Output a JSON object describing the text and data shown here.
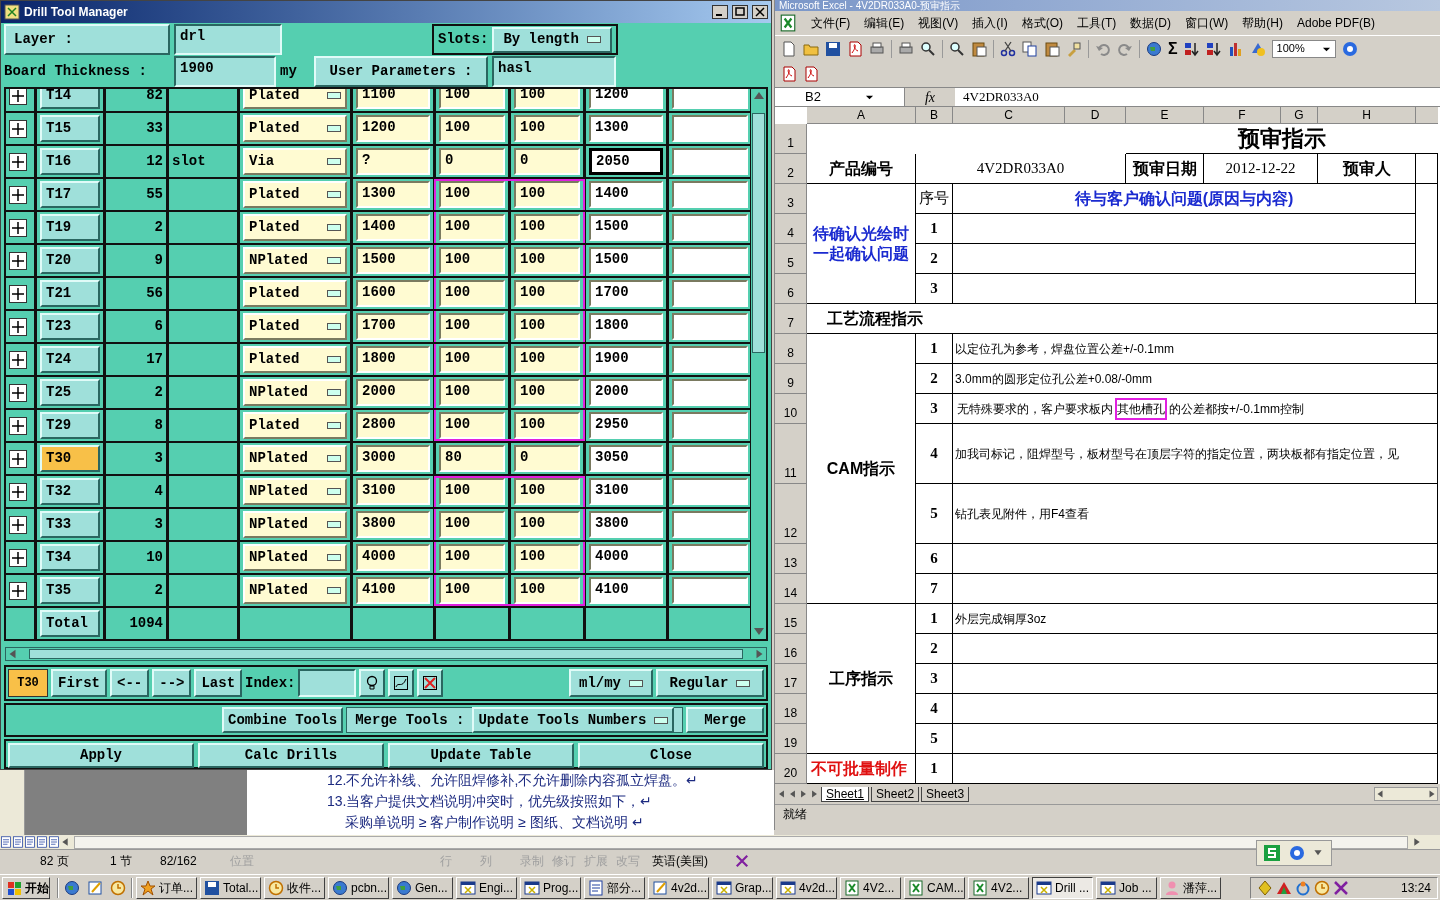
{
  "drill_window": {
    "title": "Drill Tool Manager",
    "layer_label": "Layer :",
    "layer_value": "drl",
    "slots_label": "Slots:",
    "slots_value": "By length",
    "thickness_label": "Board Thickness :",
    "thickness_value": "1900",
    "thickness_unit": "my",
    "user_params_label": "User Parameters :",
    "user_params_value": "hasl",
    "tools": [
      {
        "name": "T14",
        "count": "82",
        "plating": "Plated",
        "finished": "1100",
        "plus": "100",
        "minus": "100",
        "drill": "1200",
        "selected": false,
        "highlighted": false,
        "focused": false
      },
      {
        "name": "T15",
        "count": "33",
        "plating": "Plated",
        "finished": "1200",
        "plus": "100",
        "minus": "100",
        "drill": "1300",
        "selected": false,
        "highlighted": false,
        "focused": false
      },
      {
        "name": "T16",
        "count": "12",
        "type": "slot",
        "plating": "Via",
        "finished": "?",
        "plus": "0",
        "minus": "0",
        "drill": "2050",
        "selected": false,
        "highlighted": false,
        "focused": true
      },
      {
        "name": "T17",
        "count": "55",
        "plating": "Plated",
        "finished": "1300",
        "plus": "100",
        "minus": "100",
        "drill": "1400",
        "selected": false,
        "highlighted": true,
        "focused": false
      },
      {
        "name": "T19",
        "count": "2",
        "plating": "Plated",
        "finished": "1400",
        "plus": "100",
        "minus": "100",
        "drill": "1500",
        "selected": false,
        "highlighted": true,
        "focused": false
      },
      {
        "name": "T20",
        "count": "9",
        "plating": "NPlated",
        "finished": "1500",
        "plus": "100",
        "minus": "100",
        "drill": "1500",
        "selected": false,
        "highlighted": true,
        "focused": false
      },
      {
        "name": "T21",
        "count": "56",
        "plating": "Plated",
        "finished": "1600",
        "plus": "100",
        "minus": "100",
        "drill": "1700",
        "selected": false,
        "highlighted": true,
        "focused": false
      },
      {
        "name": "T23",
        "count": "6",
        "plating": "Plated",
        "finished": "1700",
        "plus": "100",
        "minus": "100",
        "drill": "1800",
        "selected": false,
        "highlighted": true,
        "focused": false
      },
      {
        "name": "T24",
        "count": "17",
        "plating": "Plated",
        "finished": "1800",
        "plus": "100",
        "minus": "100",
        "drill": "1900",
        "selected": false,
        "highlighted": true,
        "focused": false
      },
      {
        "name": "T25",
        "count": "2",
        "plating": "NPlated",
        "finished": "2000",
        "plus": "100",
        "minus": "100",
        "drill": "2000",
        "selected": false,
        "highlighted": true,
        "focused": false
      },
      {
        "name": "T29",
        "count": "8",
        "plating": "Plated",
        "finished": "2800",
        "plus": "100",
        "minus": "100",
        "drill": "2950",
        "selected": false,
        "highlighted": true,
        "focused": false
      },
      {
        "name": "T30",
        "count": "3",
        "plating": "NPlated",
        "finished": "3000",
        "plus": "80",
        "minus": "0",
        "drill": "3050",
        "selected": true,
        "highlighted": false,
        "focused": false
      },
      {
        "name": "T32",
        "count": "4",
        "plating": "NPlated",
        "finished": "3100",
        "plus": "100",
        "minus": "100",
        "drill": "3100",
        "selected": false,
        "highlighted": true,
        "focused": false
      },
      {
        "name": "T33",
        "count": "3",
        "plating": "NPlated",
        "finished": "3800",
        "plus": "100",
        "minus": "100",
        "drill": "3800",
        "selected": false,
        "highlighted": true,
        "focused": false
      },
      {
        "name": "T34",
        "count": "10",
        "plating": "NPlated",
        "finished": "4000",
        "plus": "100",
        "minus": "100",
        "drill": "4000",
        "selected": false,
        "highlighted": true,
        "focused": false
      },
      {
        "name": "T35",
        "count": "2",
        "plating": "NPlated",
        "finished": "4100",
        "plus": "100",
        "minus": "100",
        "drill": "4100",
        "selected": false,
        "highlighted": true,
        "focused": false
      }
    ],
    "total": {
      "label": "Total",
      "count": "1094"
    },
    "current_tool": "T30",
    "nav": [
      "First",
      "<--",
      "-->",
      "Last"
    ],
    "index_label": "Index:",
    "units": "ml/my",
    "mode": "Regular",
    "combine": "Combine Tools",
    "merge_label": "Merge Tools :",
    "merge_mode": "Update Tools Numbers",
    "merge": "Merge",
    "actions": [
      "Apply",
      "Calc Drills",
      "Update Table",
      "Close"
    ]
  },
  "excel": {
    "title": "Microsoft Excel - 4V2DR033A0-预审指示",
    "menu": [
      "文件(F)",
      "编辑(E)",
      "视图(V)",
      "插入(I)",
      "格式(O)",
      "工具(T)",
      "数据(D)",
      "窗口(W)",
      "帮助(H)",
      "Adobe PDF(B)"
    ],
    "sum": "Σ",
    "zoom": "100%",
    "name_box": "B2",
    "fx": "fx",
    "formula": "4V2DR033A0",
    "columns": [
      "A",
      "B",
      "C",
      "D",
      "E",
      "F",
      "G",
      "H"
    ],
    "rows": [
      "1",
      "2",
      "3",
      "4",
      "5",
      "6",
      "7",
      "8",
      "9",
      "10",
      "11",
      "12",
      "13",
      "14",
      "15",
      "16",
      "17",
      "18",
      "19",
      "20"
    ],
    "cells": [
      {
        "kind": "title",
        "text": "预审指示"
      },
      {
        "kind": "label",
        "text": "产品编号"
      },
      {
        "kind": "value",
        "text": "4V2DR033A0"
      },
      {
        "kind": "label",
        "text": "预审日期"
      },
      {
        "kind": "value",
        "text": "2012-12-22"
      },
      {
        "kind": "label",
        "text": "预审人"
      },
      {
        "kind": "blue",
        "text": "待确认光绘时一起确认问题"
      },
      {
        "kind": "plain",
        "text": "序号"
      },
      {
        "kind": "blue",
        "text": "待与客户确认问题(原因与内容)"
      },
      {
        "kind": "number",
        "text": "1"
      },
      {
        "kind": "number",
        "text": "2"
      },
      {
        "kind": "number",
        "text": "3"
      },
      {
        "kind": "section",
        "text": "工艺流程指示"
      },
      {
        "kind": "label",
        "text": "CAM指示"
      },
      {
        "kind": "number",
        "text": "1"
      },
      {
        "kind": "text",
        "text": "以定位孔为参考，焊盘位置公差+/-0.1mm"
      },
      {
        "kind": "number",
        "text": "2"
      },
      {
        "kind": "text",
        "text": "3.0mm的圆形定位孔公差+0.08/-0mm"
      },
      {
        "kind": "number",
        "text": "3"
      },
      {
        "kind": "text",
        "parts": [
          {
            "text": "无特殊要求的，客户要求板内",
            "highlighted": false
          },
          {
            "text": "其他槽孔",
            "highlighted": true
          },
          {
            "text": "的公差都按+/-0.1mm控制",
            "highlighted": false
          }
        ]
      },
      {
        "kind": "number",
        "text": "4"
      },
      {
        "kind": "text",
        "text": "加我司标记，阻焊型号，板材型号在顶层字符的指定位置，两块板都有指定位置，见"
      },
      {
        "kind": "number",
        "text": "5"
      },
      {
        "kind": "text",
        "text": "钻孔表见附件，用F4查看"
      },
      {
        "kind": "number",
        "text": "6"
      },
      {
        "kind": "number",
        "text": "7"
      },
      {
        "kind": "label",
        "text": "工序指示"
      },
      {
        "kind": "number",
        "text": "1"
      },
      {
        "kind": "text",
        "text": "外层完成铜厚3oz"
      },
      {
        "kind": "number",
        "text": "2"
      },
      {
        "kind": "number",
        "text": "3"
      },
      {
        "kind": "number",
        "text": "4"
      },
      {
        "kind": "number",
        "text": "5"
      },
      {
        "kind": "red",
        "text": "不可批量制作"
      },
      {
        "kind": "number",
        "text": "1"
      }
    ],
    "sheet_tabs": [
      {
        "label": "Sheet1",
        "selected": true
      },
      {
        "label": "Sheet2",
        "selected": false
      },
      {
        "label": "Sheet3",
        "selected": false
      }
    ],
    "status": "就绪"
  },
  "word": {
    "lines": [
      "12.不允许补线、允许阻焊修补,不允许删除内容孤立焊盘。↵",
      "13.当客户提供文档说明冲突时，优先级按照如下，↵",
      "采购单说明 ≥ 客户制作说明 ≥ 图纸、文档说明 ↵"
    ],
    "status": [
      {
        "text": "82 页",
        "disabled": false
      },
      {
        "text": "1 节",
        "disabled": false
      },
      {
        "text": "82/162",
        "disabled": false
      },
      {
        "text": "位置",
        "disabled": true
      },
      {
        "text": "行",
        "disabled": true
      },
      {
        "text": "列",
        "disabled": true
      },
      {
        "text": "录制",
        "disabled": true
      },
      {
        "text": "修订",
        "disabled": true
      },
      {
        "text": "扩展",
        "disabled": true
      },
      {
        "text": "改写",
        "disabled": true
      },
      {
        "text": "英语(美国)",
        "disabled": false
      }
    ]
  },
  "taskbar": {
    "start": "开始",
    "tasks": [
      {
        "label": "订单...",
        "selected": false
      },
      {
        "label": "Total...",
        "selected": false
      },
      {
        "label": "收件...",
        "selected": false
      },
      {
        "label": "pcbn...",
        "selected": false
      },
      {
        "label": "Gen...",
        "selected": false
      },
      {
        "label": "Engi...",
        "selected": false
      },
      {
        "label": "Prog...",
        "selected": false
      },
      {
        "label": "部分...",
        "selected": false
      },
      {
        "label": "4v2d...",
        "selected": false
      },
      {
        "label": "Grap...",
        "selected": false
      },
      {
        "label": "4v2d...",
        "selected": false
      },
      {
        "label": "4V2...",
        "selected": false
      },
      {
        "label": "CAM...",
        "selected": false
      },
      {
        "label": "4V2...",
        "selected": false
      },
      {
        "label": "Drill ...",
        "selected": true
      },
      {
        "label": "Job ...",
        "selected": false
      },
      {
        "label": "潘萍...",
        "selected": false
      }
    ],
    "clock": "13:24"
  }
}
